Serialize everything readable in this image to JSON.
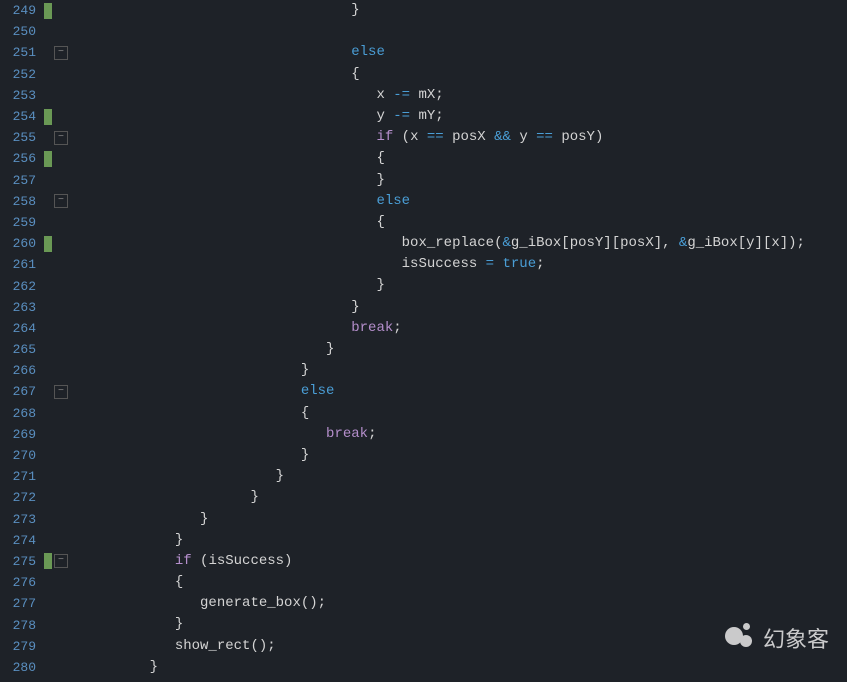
{
  "watermark_text": "幻象客",
  "lines": [
    {
      "num": "249",
      "marker": true,
      "fold": "",
      "indent": 11,
      "tokens": [
        {
          "t": "}",
          "c": "punc"
        }
      ]
    },
    {
      "num": "250",
      "marker": false,
      "fold": "",
      "indent": 0,
      "tokens": []
    },
    {
      "num": "251",
      "marker": false,
      "fold": "box",
      "indent": 11,
      "tokens": [
        {
          "t": "else",
          "c": "kw"
        }
      ]
    },
    {
      "num": "252",
      "marker": false,
      "fold": "",
      "indent": 11,
      "tokens": [
        {
          "t": "{",
          "c": "punc"
        }
      ]
    },
    {
      "num": "253",
      "marker": false,
      "fold": "",
      "indent": 12,
      "tokens": [
        {
          "t": "x ",
          "c": "var"
        },
        {
          "t": "-=",
          "c": "kw"
        },
        {
          "t": " mX",
          "c": "var"
        },
        {
          "t": ";",
          "c": "punc"
        }
      ]
    },
    {
      "num": "254",
      "marker": true,
      "fold": "",
      "indent": 12,
      "tokens": [
        {
          "t": "y ",
          "c": "var"
        },
        {
          "t": "-=",
          "c": "kw"
        },
        {
          "t": " mY",
          "c": "var"
        },
        {
          "t": ";",
          "c": "punc"
        }
      ]
    },
    {
      "num": "255",
      "marker": false,
      "fold": "box",
      "indent": 12,
      "tokens": [
        {
          "t": "if",
          "c": "ctrl"
        },
        {
          "t": " (x ",
          "c": "var"
        },
        {
          "t": "==",
          "c": "kw"
        },
        {
          "t": " posX ",
          "c": "var"
        },
        {
          "t": "&&",
          "c": "kw"
        },
        {
          "t": " y ",
          "c": "var"
        },
        {
          "t": "==",
          "c": "kw"
        },
        {
          "t": " posY)",
          "c": "var"
        }
      ]
    },
    {
      "num": "256",
      "marker": true,
      "fold": "",
      "indent": 12,
      "tokens": [
        {
          "t": "{",
          "c": "punc"
        }
      ]
    },
    {
      "num": "257",
      "marker": false,
      "fold": "",
      "indent": 12,
      "tokens": [
        {
          "t": "}",
          "c": "punc"
        }
      ]
    },
    {
      "num": "258",
      "marker": false,
      "fold": "box",
      "indent": 12,
      "tokens": [
        {
          "t": "else",
          "c": "kw"
        }
      ]
    },
    {
      "num": "259",
      "marker": false,
      "fold": "",
      "indent": 12,
      "tokens": [
        {
          "t": "{",
          "c": "punc"
        }
      ]
    },
    {
      "num": "260",
      "marker": true,
      "fold": "",
      "indent": 13,
      "tokens": [
        {
          "t": "box_replace",
          "c": "func"
        },
        {
          "t": "(",
          "c": "punc"
        },
        {
          "t": "&",
          "c": "kw"
        },
        {
          "t": "g_iBox[posY][posX], ",
          "c": "var"
        },
        {
          "t": "&",
          "c": "kw"
        },
        {
          "t": "g_iBox[y][x]);",
          "c": "var"
        }
      ]
    },
    {
      "num": "261",
      "marker": false,
      "fold": "",
      "indent": 13,
      "tokens": [
        {
          "t": "isSuccess ",
          "c": "var"
        },
        {
          "t": "=",
          "c": "kw"
        },
        {
          "t": " ",
          "c": "var"
        },
        {
          "t": "true",
          "c": "lit"
        },
        {
          "t": ";",
          "c": "punc"
        }
      ]
    },
    {
      "num": "262",
      "marker": false,
      "fold": "",
      "indent": 12,
      "tokens": [
        {
          "t": "}",
          "c": "punc"
        }
      ]
    },
    {
      "num": "263",
      "marker": false,
      "fold": "",
      "indent": 11,
      "tokens": [
        {
          "t": "}",
          "c": "punc"
        }
      ]
    },
    {
      "num": "264",
      "marker": false,
      "fold": "",
      "indent": 11,
      "tokens": [
        {
          "t": "break",
          "c": "ctrl"
        },
        {
          "t": ";",
          "c": "punc"
        }
      ]
    },
    {
      "num": "265",
      "marker": false,
      "fold": "",
      "indent": 10,
      "tokens": [
        {
          "t": "}",
          "c": "punc"
        }
      ]
    },
    {
      "num": "266",
      "marker": false,
      "fold": "",
      "indent": 9,
      "tokens": [
        {
          "t": "}",
          "c": "punc"
        }
      ]
    },
    {
      "num": "267",
      "marker": false,
      "fold": "box",
      "indent": 9,
      "tokens": [
        {
          "t": "else",
          "c": "kw"
        }
      ]
    },
    {
      "num": "268",
      "marker": false,
      "fold": "",
      "indent": 9,
      "tokens": [
        {
          "t": "{",
          "c": "punc"
        }
      ]
    },
    {
      "num": "269",
      "marker": false,
      "fold": "",
      "indent": 10,
      "tokens": [
        {
          "t": "break",
          "c": "ctrl"
        },
        {
          "t": ";",
          "c": "punc"
        }
      ]
    },
    {
      "num": "270",
      "marker": false,
      "fold": "",
      "indent": 9,
      "tokens": [
        {
          "t": "}",
          "c": "punc"
        }
      ]
    },
    {
      "num": "271",
      "marker": false,
      "fold": "",
      "indent": 8,
      "tokens": [
        {
          "t": "}",
          "c": "punc"
        }
      ]
    },
    {
      "num": "272",
      "marker": false,
      "fold": "",
      "indent": 7,
      "tokens": [
        {
          "t": "}",
          "c": "punc"
        }
      ]
    },
    {
      "num": "273",
      "marker": false,
      "fold": "",
      "indent": 5,
      "tokens": [
        {
          "t": "}",
          "c": "punc"
        }
      ]
    },
    {
      "num": "274",
      "marker": false,
      "fold": "",
      "indent": 4,
      "tokens": [
        {
          "t": "}",
          "c": "punc"
        }
      ]
    },
    {
      "num": "275",
      "marker": true,
      "fold": "box",
      "indent": 4,
      "tokens": [
        {
          "t": "if",
          "c": "ctrl"
        },
        {
          "t": " (isSuccess)",
          "c": "var"
        }
      ]
    },
    {
      "num": "276",
      "marker": false,
      "fold": "",
      "indent": 4,
      "tokens": [
        {
          "t": "{",
          "c": "punc"
        }
      ]
    },
    {
      "num": "277",
      "marker": false,
      "fold": "",
      "indent": 5,
      "tokens": [
        {
          "t": "generate_box",
          "c": "func"
        },
        {
          "t": "();",
          "c": "punc"
        }
      ]
    },
    {
      "num": "278",
      "marker": false,
      "fold": "",
      "indent": 4,
      "tokens": [
        {
          "t": "}",
          "c": "punc"
        }
      ]
    },
    {
      "num": "279",
      "marker": false,
      "fold": "",
      "indent": 4,
      "tokens": [
        {
          "t": "show_rect",
          "c": "func"
        },
        {
          "t": "();",
          "c": "punc"
        }
      ]
    },
    {
      "num": "280",
      "marker": false,
      "fold": "",
      "indent": 3,
      "tokens": [
        {
          "t": "}",
          "c": "punc"
        }
      ]
    }
  ]
}
